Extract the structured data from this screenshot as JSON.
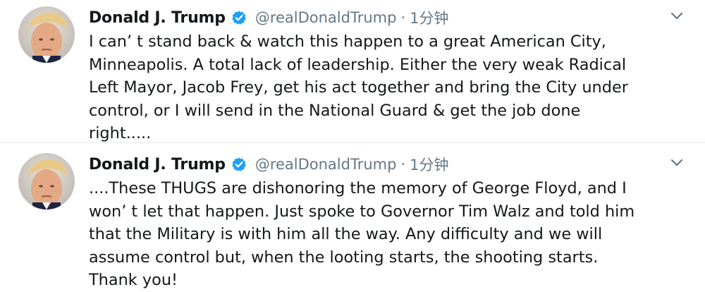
{
  "tweets": [
    {
      "author_name": "Donald J. Trump",
      "handle": "@realDonaldTrump",
      "separator": "·",
      "timestamp": "1分钟",
      "verified_icon": "verified-badge-icon",
      "menu_icon": "chevron-down-icon",
      "text_lines": [
        "I can’ t stand back & watch this happen to a great American City,",
        "Minneapolis. A total lack of leadership. Either the very weak Radical",
        "Left Mayor, Jacob Frey, get his act together and bring the City under",
        "control, or I will send in the National Guard & get the job done",
        "right....."
      ]
    },
    {
      "author_name": "Donald J. Trump",
      "handle": "@realDonaldTrump",
      "separator": "·",
      "timestamp": "1分钟",
      "verified_icon": "verified-badge-icon",
      "menu_icon": "chevron-down-icon",
      "text_lines": [
        "....These THUGS are dishonoring the memory of George Floyd, and I",
        "won’ t let that happen. Just spoke to Governor Tim Walz and told him",
        "that the Military is with him all the way. Any difficulty and we will",
        "assume control but, when the looting starts, the shooting starts.",
        "Thank you!"
      ]
    }
  ],
  "colors": {
    "verified_blue": "#1da1f2",
    "secondary_text": "#657786",
    "primary_text": "#14171a",
    "divider": "#e6ecf0"
  }
}
